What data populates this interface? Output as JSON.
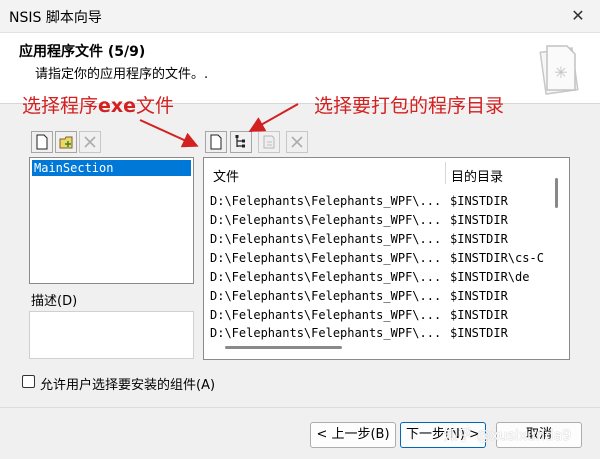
{
  "window": {
    "title": "NSIS 脚本向导",
    "close_glyph": "✕"
  },
  "header": {
    "title": "应用程序文件 (5/9)",
    "subtitle": "请指定你的应用程序的文件。."
  },
  "annotations": {
    "left_prefix": "选择程序",
    "left_bold": "exe",
    "left_suffix": "文件",
    "right": "选择要打包的程序目录",
    "color": "#d32020"
  },
  "sections": {
    "items": [
      "MainSection"
    ]
  },
  "description": {
    "label": "描述(D)"
  },
  "files": {
    "col_file": "文件",
    "col_target": "目的目录",
    "rows": [
      {
        "file": "D:\\Felephants\\Felephants_WPF\\...",
        "target": "$INSTDIR"
      },
      {
        "file": "D:\\Felephants\\Felephants_WPF\\...",
        "target": "$INSTDIR"
      },
      {
        "file": "D:\\Felephants\\Felephants_WPF\\...",
        "target": "$INSTDIR"
      },
      {
        "file": "D:\\Felephants\\Felephants_WPF\\...",
        "target": "$INSTDIR\\cs-C"
      },
      {
        "file": "D:\\Felephants\\Felephants_WPF\\...",
        "target": "$INSTDIR\\de"
      },
      {
        "file": "D:\\Felephants\\Felephants_WPF\\...",
        "target": "$INSTDIR"
      },
      {
        "file": "D:\\Felephants\\Felephants_WPF\\...",
        "target": "$INSTDIR"
      },
      {
        "file": "D:\\Felephants\\Felephants_WPF\\...",
        "target": "$INSTDIR"
      }
    ]
  },
  "options": {
    "allow_choose_label": "允许用户选择要安装的组件(A)"
  },
  "buttons": {
    "back": "< 上一步(B)",
    "next": "下一步(N) >",
    "cancel": "取消"
  },
  "watermark": "知乎 @xusixunda9",
  "colors": {
    "selection": "#0078d7",
    "accent": "#0067c0"
  }
}
